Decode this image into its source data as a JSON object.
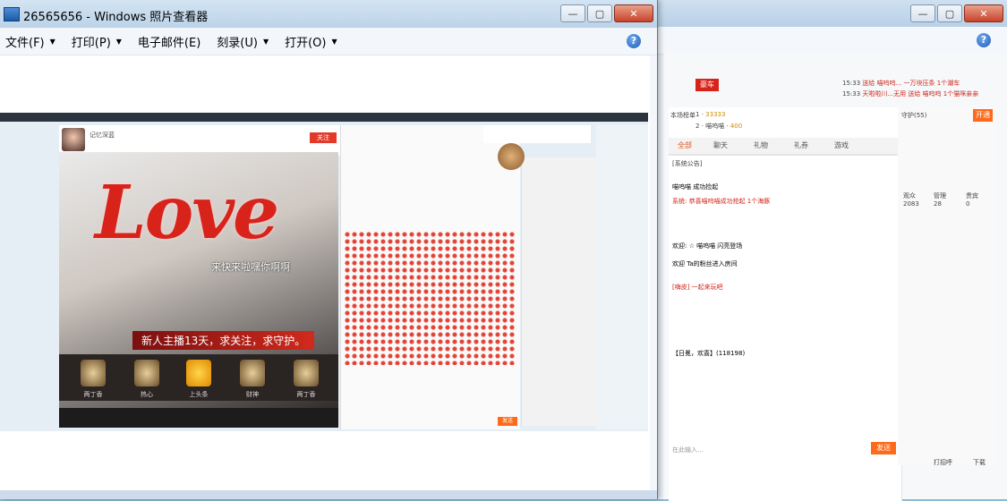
{
  "window": {
    "title": "26565656 - Windows 照片查看器",
    "menu": [
      {
        "label": "文件(F)",
        "has_caret": true
      },
      {
        "label": "打印(P)",
        "has_caret": true
      },
      {
        "label": "电子邮件(E)",
        "has_caret": false
      },
      {
        "label": "刻录(U)",
        "has_caret": true
      },
      {
        "label": "打开(O)",
        "has_caret": true
      }
    ],
    "help_glyph": "?",
    "buttons": {
      "minimize": "—",
      "maximize": "▢",
      "close": "✕"
    }
  },
  "photo": {
    "love_text": "Love",
    "caption": "来快来啦嘿你啊啊",
    "newbie_banner": "新人主播13天，求关注，求守护。",
    "gifts": [
      "两丁香",
      "热心",
      "上头条",
      "财神",
      "两丁香"
    ],
    "streamer_name": "记忆深蓝",
    "follow_label": "关注",
    "send_label": "发送"
  },
  "bg_window": {
    "help_glyph": "?",
    "badge_top": "豪车",
    "notices": [
      {
        "time": "15:33",
        "text": "送给 喵呜呜... 一万块压条 1个潮车"
      },
      {
        "time": "15:33",
        "text": "天啦啦川...无用 送给 喵呜呜 1个猫咪亲亲"
      }
    ],
    "rank_label": "本场榜单",
    "rank_rows": [
      {
        "rank": "1",
        "value": "33333"
      },
      {
        "rank": "2",
        "name": "喵呜喵",
        "value": "400"
      }
    ],
    "tabs": [
      "全部",
      "聊天",
      "礼物",
      "礼券",
      "游戏"
    ],
    "announcement": "[系统公告]",
    "guard_label": "守护(55)",
    "open_guard": "开通",
    "stats": [
      {
        "label": "观众",
        "value": "2083"
      },
      {
        "label": "管理",
        "value": "28"
      },
      {
        "label": "贵宾",
        "value": "0"
      }
    ],
    "chat_lines": [
      "喵呜喵 成功捡起",
      "系统: 恭喜喵呜喵成功抢起 1个海豚",
      "欢迎: ☆ 喵呜喵 闪亮登场",
      "欢迎 Ta的粉丝进入房间",
      "[嗨皮] 一起来玩吧",
      "【日冕，欢喜】(118198)"
    ],
    "input_placeholder": "在此输入...",
    "send_label": "发送",
    "footer_labels": [
      "打招呼",
      "下载"
    ]
  }
}
